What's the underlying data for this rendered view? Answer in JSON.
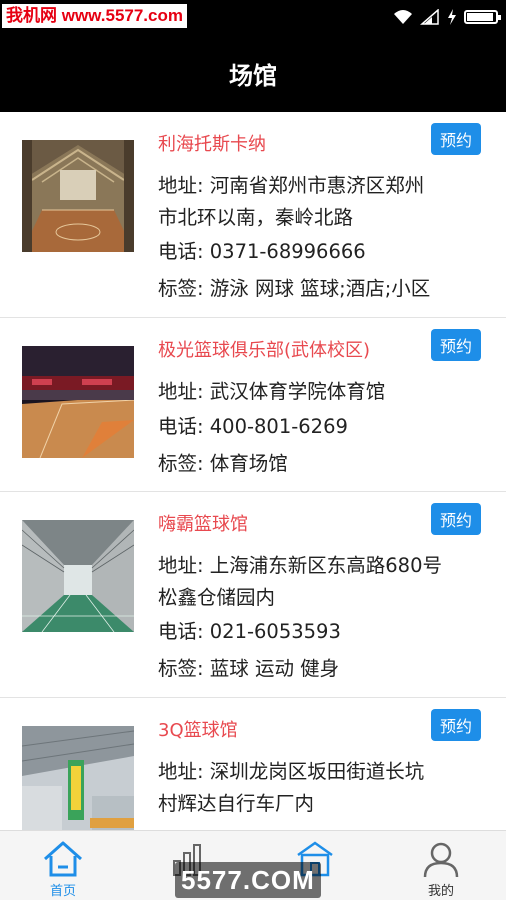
{
  "watermark_top": "我机网 www.5577.com",
  "watermark_bottom": "5577.COM",
  "status_bar": {
    "icons": [
      "wifi-icon",
      "signal-icon",
      "charging-icon",
      "battery-icon"
    ]
  },
  "header": {
    "title": "场馆"
  },
  "venues": [
    {
      "name": "利海托斯卡纳",
      "book_label": "预约",
      "address_lines": [
        "地址: 河南省郑州市惠济区郑州",
        "市北环以南，秦岭北路"
      ],
      "phone": "电话: 0371-68996666",
      "tags": "标签: 游泳 网球 篮球;酒店;小区"
    },
    {
      "name": "极光篮球俱乐部(武体校区)",
      "book_label": "预约",
      "address_lines": [
        "地址: 武汉体育学院体育馆"
      ],
      "phone": "电话: 400-801-6269",
      "tags": "标签: 体育场馆"
    },
    {
      "name": "嗨霸篮球馆",
      "book_label": "预约",
      "address_lines": [
        "地址: 上海浦东新区东高路680号",
        "松鑫仓储园内"
      ],
      "phone": "电话: 021-6053593",
      "tags": "标签: 蓝球 运动 健身"
    },
    {
      "name": "3Q篮球馆",
      "book_label": "预约",
      "address_lines": [
        "地址: 深圳龙岗区坂田街道长坑",
        "村辉达自行车厂内"
      ],
      "phone": "",
      "tags": ""
    }
  ],
  "bottom_nav": [
    {
      "label": "首页",
      "icon": "home-icon",
      "active": true
    },
    {
      "label": "",
      "icon": "chart-icon",
      "active": false
    },
    {
      "label": "",
      "icon": "venue-icon",
      "active": false
    },
    {
      "label": "我的",
      "icon": "user-icon",
      "active": false
    }
  ],
  "colors": {
    "accent": "#1e8ee8",
    "venue_name": "#e8494f",
    "header_bg": "#000000"
  }
}
